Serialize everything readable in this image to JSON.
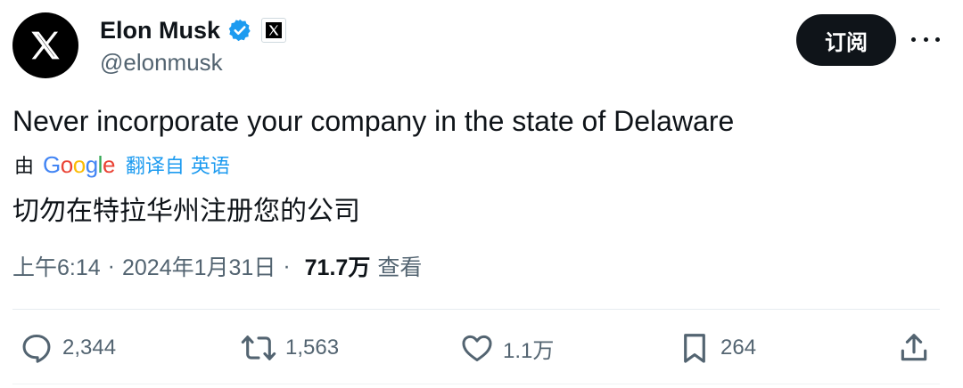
{
  "author": {
    "name": "Elon Musk",
    "handle": "@elonmusk",
    "verified_color": "#1d9bf0"
  },
  "follow_button": {
    "label": "订阅"
  },
  "more_icon": "more-horizontal-icon",
  "tweet": {
    "text": "Never incorporate your company in the state of Delaware",
    "translation": {
      "by_label": "由",
      "provider": "Google",
      "link_label": "翻译自 英语",
      "translated_text": "切勿在特拉华州注册您的公司"
    }
  },
  "meta": {
    "time": "上午6:14",
    "separator": "·",
    "date": "2024年1月31日",
    "views": "71.7万",
    "views_label": "查看"
  },
  "actions": {
    "replies": {
      "icon": "reply-icon",
      "count": "2,344"
    },
    "reposts": {
      "icon": "repost-icon",
      "count": "1,563"
    },
    "likes": {
      "icon": "heart-icon",
      "count": "1.1万"
    },
    "bookmarks": {
      "icon": "bookmark-icon",
      "count": "264"
    },
    "share": {
      "icon": "share-icon"
    }
  }
}
